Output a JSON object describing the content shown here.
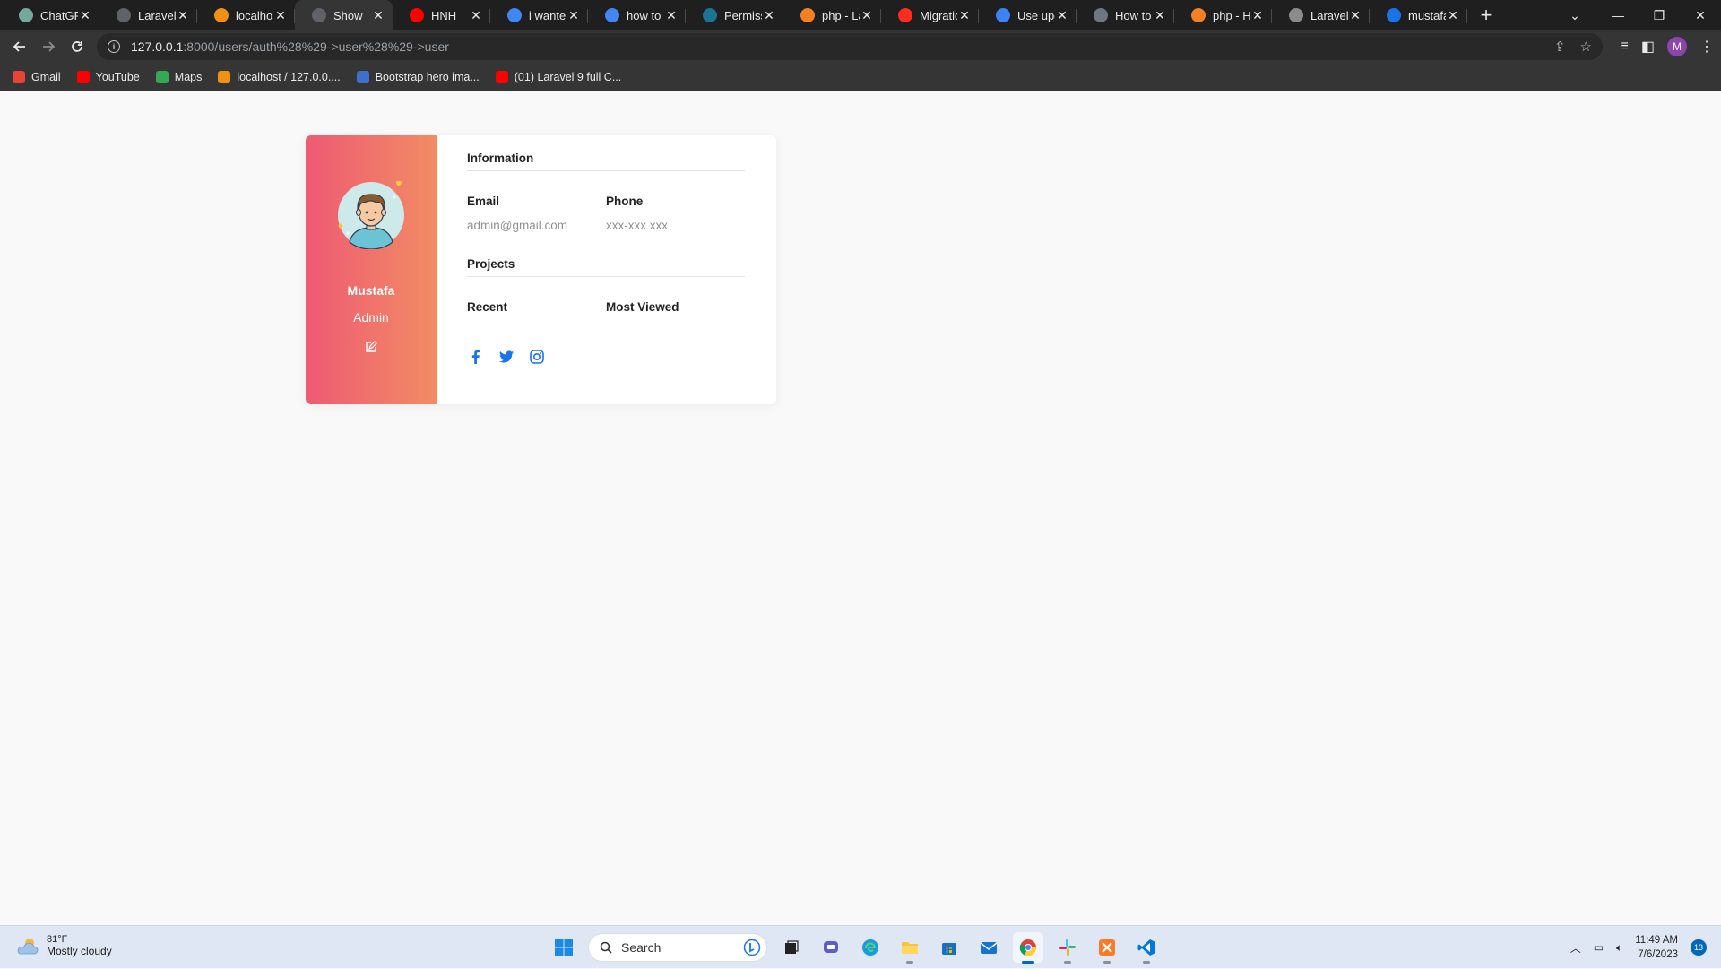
{
  "browser": {
    "tabs": [
      {
        "title": "ChatGPT",
        "icon": "chatgpt-icon",
        "color": "#74aa9c"
      },
      {
        "title": "Laravel",
        "icon": "globe-icon",
        "color": "#5f6368"
      },
      {
        "title": "localhos",
        "icon": "phpmyadmin-icon",
        "color": "#f29111"
      },
      {
        "title": "Show",
        "icon": "globe-icon",
        "color": "#5f6368",
        "active": true
      },
      {
        "title": "HNH",
        "icon": "youtube-icon",
        "color": "#ff0000"
      },
      {
        "title": "i wanted",
        "icon": "google-icon",
        "color": "#4285f4"
      },
      {
        "title": "how to u",
        "icon": "google-icon",
        "color": "#4285f4"
      },
      {
        "title": "Permissi",
        "icon": "spatie-icon",
        "color": "#197593"
      },
      {
        "title": "php - La",
        "icon": "stackoverflow-icon",
        "color": "#f48024"
      },
      {
        "title": "Migratio",
        "icon": "laravel-icon",
        "color": "#ff2d20"
      },
      {
        "title": "Use upd",
        "icon": "bookmark-icon",
        "color": "#3b82f6"
      },
      {
        "title": "How to u",
        "icon": "github-icon",
        "color": "#6e7681"
      },
      {
        "title": "php - Ho",
        "icon": "stackoverflow-icon",
        "color": "#f48024"
      },
      {
        "title": "Laravel /",
        "icon": "laracasts-icon",
        "color": "#8b8b8b"
      },
      {
        "title": "mustafa",
        "icon": "shield-icon",
        "color": "#1a73e8"
      }
    ],
    "new_tab": "+",
    "url_host": "127.0.0.1",
    "url_rest": ":8000/users/auth%28%29->user%28%29->user",
    "profile_initial": "M",
    "bookmarks": [
      {
        "label": "Gmail",
        "icon": "gmail-icon",
        "color": "#ea4335"
      },
      {
        "label": "YouTube",
        "icon": "youtube-icon",
        "color": "#ff0000"
      },
      {
        "label": "Maps",
        "icon": "maps-icon",
        "color": "#34a853"
      },
      {
        "label": "localhost / 127.0.0....",
        "icon": "phpmyadmin-icon",
        "color": "#f29111"
      },
      {
        "label": "Bootstrap hero ima...",
        "icon": "mdb-icon",
        "color": "#3b71ca"
      },
      {
        "label": "(01) Laravel 9 full C...",
        "icon": "youtube-icon",
        "color": "#ff0000"
      }
    ]
  },
  "profile_card": {
    "name": "Mustafa",
    "role": "Admin",
    "gradient_start": "#ee5a73",
    "gradient_end": "#f28c64",
    "information": {
      "heading": "Information",
      "email_label": "Email",
      "email_value": "admin@gmail.com",
      "phone_label": "Phone",
      "phone_value": "xxx-xxx xxx"
    },
    "projects": {
      "heading": "Projects",
      "recent_label": "Recent",
      "most_viewed_label": "Most Viewed"
    },
    "social_color": "#1a73e8"
  },
  "taskbar": {
    "weather_temp": "81°F",
    "weather_desc": "Mostly cloudy",
    "search_placeholder": "Search",
    "time": "11:49 AM",
    "date": "7/6/2023",
    "notification_count": "13"
  }
}
